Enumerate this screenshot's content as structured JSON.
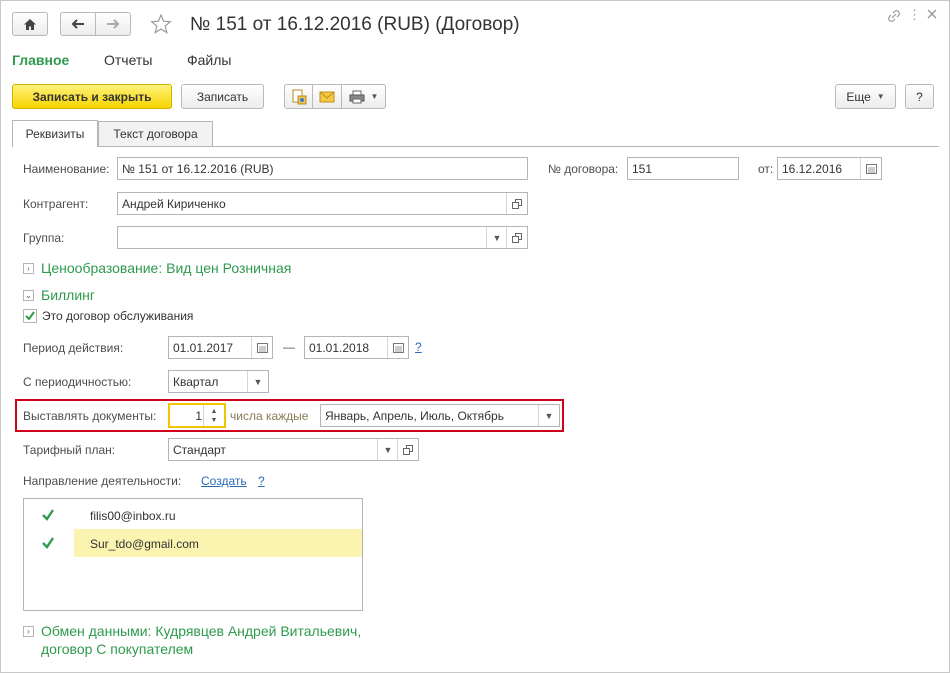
{
  "title": "№ 151 от 16.12.2016 (RUB) (Договор)",
  "top_menu": {
    "main": "Главное",
    "reports": "Отчеты",
    "files": "Файлы"
  },
  "toolbar": {
    "save_close": "Записать и закрыть",
    "save": "Записать",
    "more": "Еще",
    "help": "?"
  },
  "tabs": {
    "details": "Реквизиты",
    "contract_text": "Текст договора"
  },
  "form": {
    "name_label": "Наименование:",
    "name_value": "№ 151 от 16.12.2016 (RUB)",
    "number_label": "№ договора:",
    "number_value": "151",
    "date_label": "от:",
    "date_value": "16.12.2016",
    "counterparty_label": "Контрагент:",
    "counterparty_value": "Андрей Кириченко",
    "group_label": "Группа:",
    "group_value": ""
  },
  "pricing_section": "Ценообразование: Вид цен Розничная",
  "billing": {
    "section": "Биллинг",
    "service_contract_label": "Это договор обслуживания",
    "period_label": "Период действия:",
    "period_from": "01.01.2017",
    "period_dash": "—",
    "period_to": "01.01.2018",
    "period_help": "?",
    "periodicity_label": "С периодичностью:",
    "periodicity_value": "Квартал",
    "issue_label": "Выставлять документы:",
    "issue_day": "1",
    "issue_middle": "числа каждые",
    "issue_months": "Январь, Апрель, Июль, Октябрь",
    "tariff_label": "Тарифный план:",
    "tariff_value": "Стандарт",
    "direction_label": "Направление деятельности:",
    "create_link": "Создать",
    "direction_help": "?",
    "emails": [
      "filis00@inbox.ru",
      "Sur_tdo@gmail.com"
    ]
  },
  "exchange_section": {
    "line1": "Обмен данными: Кудрявцев Андрей Витальевич,",
    "line2": "договор С покупателем"
  },
  "colors": {
    "accent_green": "#2e9a4e",
    "highlight_red": "#d0021b",
    "primary_yellow": "#f6d400",
    "selected_row": "#fbf3b0"
  }
}
